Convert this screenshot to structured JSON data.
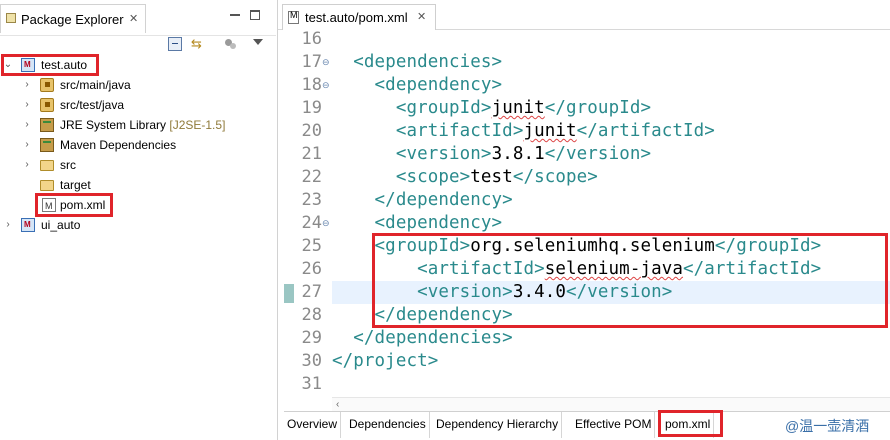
{
  "package_explorer": {
    "title": "Package Explorer",
    "close": "✕",
    "tree": [
      {
        "label": "test.auto",
        "icon": "maven-project-icon",
        "expanded": true
      },
      {
        "label": "src/main/java",
        "icon": "package-root-icon"
      },
      {
        "label": "src/test/java",
        "icon": "package-root-icon"
      },
      {
        "label": "JRE System Library",
        "decor": "[J2SE-1.5]",
        "icon": "library-icon"
      },
      {
        "label": "Maven Dependencies",
        "icon": "library-icon"
      },
      {
        "label": "src",
        "icon": "folder-icon"
      },
      {
        "label": "target",
        "icon": "folder-icon"
      },
      {
        "label": "pom.xml",
        "icon": "maven-file-icon"
      },
      {
        "label": "ui_auto",
        "icon": "maven-project-icon",
        "expanded": false
      }
    ]
  },
  "editor": {
    "tab_title": "test.auto/pom.xml",
    "close": "✕",
    "lines": [
      {
        "n": "16",
        "parts": []
      },
      {
        "n": "17",
        "fold": true,
        "indent": "  ",
        "parts": [
          [
            "tag",
            "<dependencies>"
          ]
        ]
      },
      {
        "n": "18",
        "fold": true,
        "indent": "    ",
        "parts": [
          [
            "tag",
            "<dependency>"
          ]
        ]
      },
      {
        "n": "19",
        "indent": "      ",
        "parts": [
          [
            "tag",
            "<groupId>"
          ],
          [
            "sq",
            "junit"
          ],
          [
            "tag",
            "</groupId>"
          ]
        ]
      },
      {
        "n": "20",
        "indent": "      ",
        "parts": [
          [
            "tag",
            "<artifactId>"
          ],
          [
            "sq",
            "junit"
          ],
          [
            "tag",
            "</artifactId>"
          ]
        ]
      },
      {
        "n": "21",
        "indent": "      ",
        "parts": [
          [
            "tag",
            "<version>"
          ],
          [
            "txt",
            "3.8.1"
          ],
          [
            "tag",
            "</version>"
          ]
        ]
      },
      {
        "n": "22",
        "indent": "      ",
        "parts": [
          [
            "tag",
            "<scope>"
          ],
          [
            "txt",
            "test"
          ],
          [
            "tag",
            "</scope>"
          ]
        ]
      },
      {
        "n": "23",
        "indent": "    ",
        "parts": [
          [
            "tag",
            "</dependency>"
          ]
        ]
      },
      {
        "n": "24",
        "fold": true,
        "indent": "    ",
        "parts": [
          [
            "tag",
            "<dependency>"
          ]
        ]
      },
      {
        "n": "25",
        "indent": "    ",
        "parts": [
          [
            "tag",
            "<groupId>"
          ],
          [
            "txt",
            "org.seleniumhq.selenium"
          ],
          [
            "tag",
            "</groupId>"
          ]
        ]
      },
      {
        "n": "26",
        "indent": "        ",
        "parts": [
          [
            "tag",
            "<artifactId>"
          ],
          [
            "sq",
            "selenium-java"
          ],
          [
            "tag",
            "</artifactId>"
          ]
        ]
      },
      {
        "n": "27",
        "indent": "        ",
        "parts": [
          [
            "tag",
            "<version>"
          ],
          [
            "txt",
            "3.4.0"
          ],
          [
            "tag",
            "</version>"
          ]
        ]
      },
      {
        "n": "28",
        "indent": "    ",
        "parts": [
          [
            "tag",
            "</dependency>"
          ]
        ]
      },
      {
        "n": "29",
        "indent": "  ",
        "parts": [
          [
            "tag",
            "</dependencies>"
          ]
        ]
      },
      {
        "n": "30",
        "indent": "",
        "parts": [
          [
            "tag",
            "</project>"
          ]
        ]
      },
      {
        "n": "31",
        "parts": []
      }
    ],
    "bottom_tabs": [
      "Overview",
      "Dependencies",
      "Dependency Hierarchy",
      "Effective POM",
      "pom.xml"
    ],
    "active_bottom_tab": "pom.xml"
  },
  "watermark": "@温一壶清酒",
  "colors": {
    "tag": "#2a8a8c",
    "highlight_box": "#e0242a",
    "current_line": "#e8f2fe"
  }
}
